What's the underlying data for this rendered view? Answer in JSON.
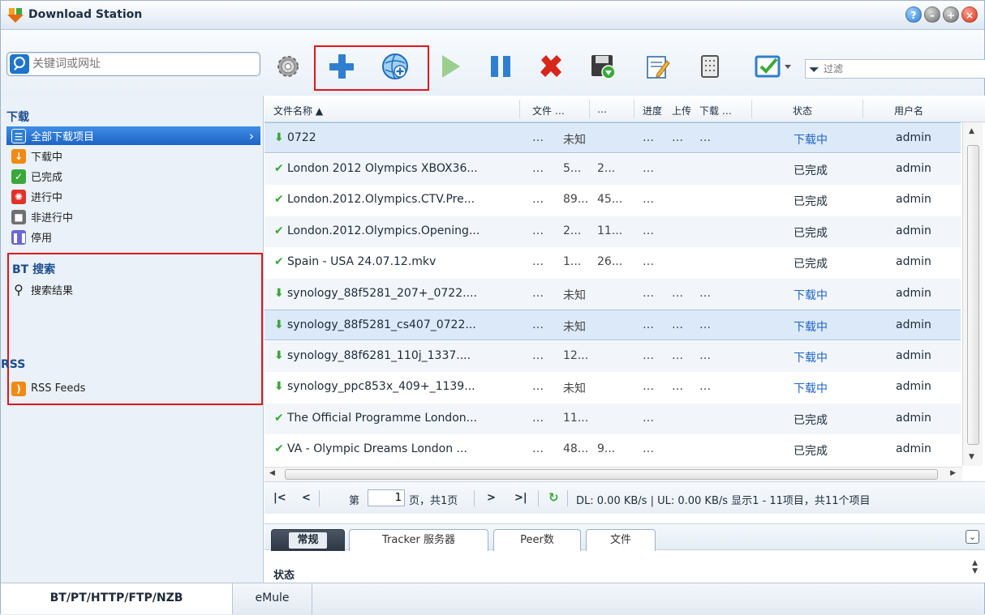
{
  "window": {
    "title": "Download Station"
  },
  "search": {
    "placeholder": "关键词或网址"
  },
  "toolbar": {
    "tools": [
      "settings-icon",
      "add-icon",
      "add-url-icon",
      "resume-icon",
      "pause-icon",
      "delete-icon",
      "save-icon",
      "edit-icon",
      "clear-icon",
      "select-icon"
    ],
    "filter_placeholder": "过滤"
  },
  "sidebar": {
    "group_download": "下载",
    "items": [
      {
        "label": "全部下载项目",
        "icon": "list-icon",
        "color": "#2f7fd0"
      },
      {
        "label": "下载中",
        "icon": "download-icon",
        "color": "#f08a12"
      },
      {
        "label": "已完成",
        "icon": "check-icon",
        "color": "#3aa83a"
      },
      {
        "label": "进行中",
        "icon": "active-icon",
        "color": "#e0322a"
      },
      {
        "label": "非进行中",
        "icon": "inactive-icon",
        "color": "#6f6f6f"
      },
      {
        "label": "停用",
        "icon": "pause-icon",
        "color": "#6b66d6"
      }
    ],
    "group_bt": "BT 搜索",
    "search_results": "搜索结果",
    "group_rss": "RSS",
    "rss_feeds": "RSS Feeds"
  },
  "table": {
    "columns": [
      "文件名称 ▲",
      "文件 …",
      "…",
      "进度",
      "上传",
      "下载 …",
      "状态",
      "用户名"
    ],
    "rows": [
      {
        "name": "0722",
        "c1": "…",
        "c2": "未知",
        "c3": "",
        "c4": "…",
        "c5": "…",
        "c6": "…",
        "status": "下载中",
        "user": "admin",
        "state": "downloading"
      },
      {
        "name": "London 2012 Olympics XBOX36...",
        "c1": "…",
        "c2": "5...",
        "c3": "2...",
        "c4": "…",
        "c5": "",
        "c6": "",
        "status": "已完成",
        "user": "admin",
        "state": "finished"
      },
      {
        "name": "London.2012.Olympics.CTV.Pre...",
        "c1": "…",
        "c2": "89...",
        "c3": "45...",
        "c4": "…",
        "c5": "",
        "c6": "",
        "status": "已完成",
        "user": "admin",
        "state": "finished"
      },
      {
        "name": "London.2012.Olympics.Opening...",
        "c1": "…",
        "c2": "2...",
        "c3": "11...",
        "c4": "…",
        "c5": "",
        "c6": "",
        "status": "已完成",
        "user": "admin",
        "state": "finished"
      },
      {
        "name": "Spain - USA 24.07.12.mkv",
        "c1": "…",
        "c2": "1...",
        "c3": "26...",
        "c4": "…",
        "c5": "",
        "c6": "",
        "status": "已完成",
        "user": "admin",
        "state": "finished"
      },
      {
        "name": "synology_88f5281_207+_0722....",
        "c1": "…",
        "c2": "未知",
        "c3": "",
        "c4": "…",
        "c5": "…",
        "c6": "…",
        "status": "下载中",
        "user": "admin",
        "state": "downloading"
      },
      {
        "name": "synology_88f5281_cs407_0722...",
        "c1": "…",
        "c2": "未知",
        "c3": "",
        "c4": "…",
        "c5": "…",
        "c6": "…",
        "status": "下载中",
        "user": "admin",
        "state": "downloading"
      },
      {
        "name": "synology_88f6281_110j_1337....",
        "c1": "…",
        "c2": "12...",
        "c3": "",
        "c4": "…",
        "c5": "…",
        "c6": "…",
        "status": "下载中",
        "user": "admin",
        "state": "downloading"
      },
      {
        "name": "synology_ppc853x_409+_1139...",
        "c1": "…",
        "c2": "未知",
        "c3": "",
        "c4": "…",
        "c5": "…",
        "c6": "…",
        "status": "下载中",
        "user": "admin",
        "state": "downloading"
      },
      {
        "name": "The Official Programme London...",
        "c1": "…",
        "c2": "11...",
        "c3": "",
        "c4": "…",
        "c5": "",
        "c6": "",
        "status": "已完成",
        "user": "admin",
        "state": "finished"
      },
      {
        "name": "VA - Olympic Dreams London ...",
        "c1": "…",
        "c2": "48...",
        "c3": "9...",
        "c4": "…",
        "c5": "",
        "c6": "",
        "status": "已完成",
        "user": "admin",
        "state": "finished"
      }
    ]
  },
  "pager": {
    "page_prefix": "第",
    "page_value": "1",
    "page_suffix": "页，共1页",
    "stats": "DL: 0.00 KB/s | UL: 0.00 KB/s 显示1 - 11项目，共11个项目"
  },
  "detail": {
    "tabs": [
      "常规",
      "Tracker 服务器",
      "Peer数",
      "文件"
    ],
    "section": "状态"
  },
  "bottom": {
    "tabs": [
      "BT/PT/HTTP/FTP/NZB",
      "eMule"
    ]
  }
}
